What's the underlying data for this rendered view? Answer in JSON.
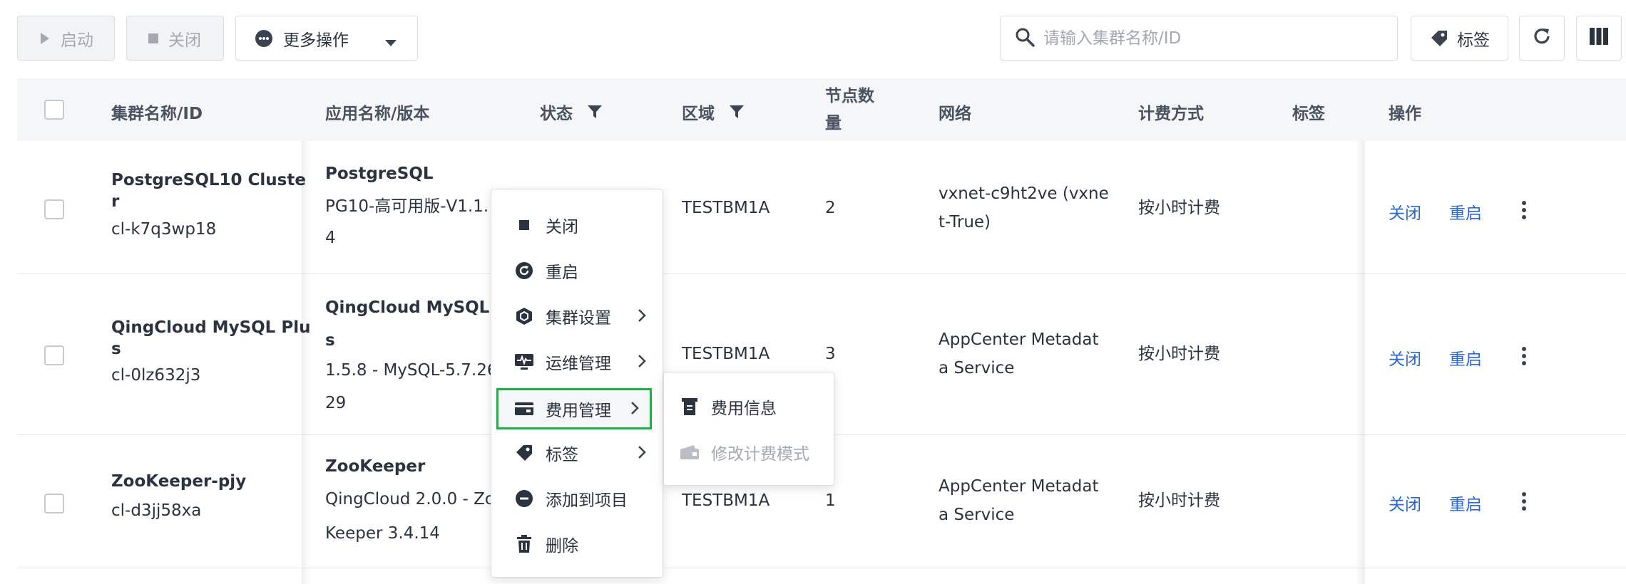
{
  "toolbar": {
    "start_label": "启动",
    "close_label": "关闭",
    "more_label": "更多操作",
    "search_placeholder": "请输入集群名称/ID",
    "tags_label": "标签"
  },
  "table": {
    "headers": {
      "name": "集群名称/ID",
      "app": "应用名称/版本",
      "status": "状态",
      "region": "区域",
      "nodes": "节点数量",
      "network": "网络",
      "billing": "计费方式",
      "tags": "标签",
      "actions": "操作"
    },
    "rows": [
      {
        "name_line1": "PostgreSQL10 Cluste",
        "name_line2": "r",
        "id": "cl-k7q3wp18",
        "app_name": "PostgreSQL",
        "app_version_line1": "PG10-高可用版-V1.1.",
        "app_version_line2": "4",
        "region": "TESTBM1A",
        "nodes": "2",
        "network_line1": "vxnet-c9ht2ve (vxne",
        "network_line2": "t-True)",
        "billing": "按小时计费",
        "action_close": "关闭",
        "action_restart": "重启"
      },
      {
        "name_line1": "QingCloud MySQL Plu",
        "name_line2": "s",
        "id": "cl-0lz632j3",
        "app_name_line1": "QingCloud MySQL Plu",
        "app_name_line2": "s",
        "app_version_line1": "1.5.8 - MySQL-5.7.26-",
        "app_version_line2": "29",
        "region": "TESTBM1A",
        "nodes": "3",
        "network_line1": "AppCenter Metadat",
        "network_line2": "a Service",
        "billing": "按小时计费",
        "action_close": "关闭",
        "action_restart": "重启"
      },
      {
        "name_line1": "ZooKeeper-pjy",
        "id": "cl-d3jj58xa",
        "app_name": "ZooKeeper",
        "app_version_line1": "QingCloud 2.0.0 - Zoo",
        "app_version_line2": "Keeper 3.4.14",
        "region": "TESTBM1A",
        "nodes": "1",
        "network_line1": "AppCenter Metadat",
        "network_line2": "a Service",
        "billing": "按小时计费",
        "action_close": "关闭",
        "action_restart": "重启"
      }
    ]
  },
  "context_menu": {
    "items": [
      {
        "label": "关闭",
        "icon": "stop-icon"
      },
      {
        "label": "重启",
        "icon": "restart-icon"
      },
      {
        "label": "集群设置",
        "icon": "cube-icon"
      },
      {
        "label": "运维管理",
        "icon": "monitor-icon"
      },
      {
        "label": "费用管理",
        "icon": "wallet-icon"
      },
      {
        "label": "标签",
        "icon": "tag-icon"
      },
      {
        "label": "添加到项目",
        "icon": "add-to-project-icon"
      },
      {
        "label": "删除",
        "icon": "trash-icon"
      }
    ]
  },
  "submenu": {
    "items": [
      {
        "label": "费用信息",
        "icon": "receipt-icon",
        "disabled": false
      },
      {
        "label": "修改计费模式",
        "icon": "wallet-icon",
        "disabled": true
      }
    ]
  },
  "colors": {
    "link": "#2a6ad4",
    "highlight_outline": "#1db042",
    "header_bg": "#f4f6f8"
  }
}
